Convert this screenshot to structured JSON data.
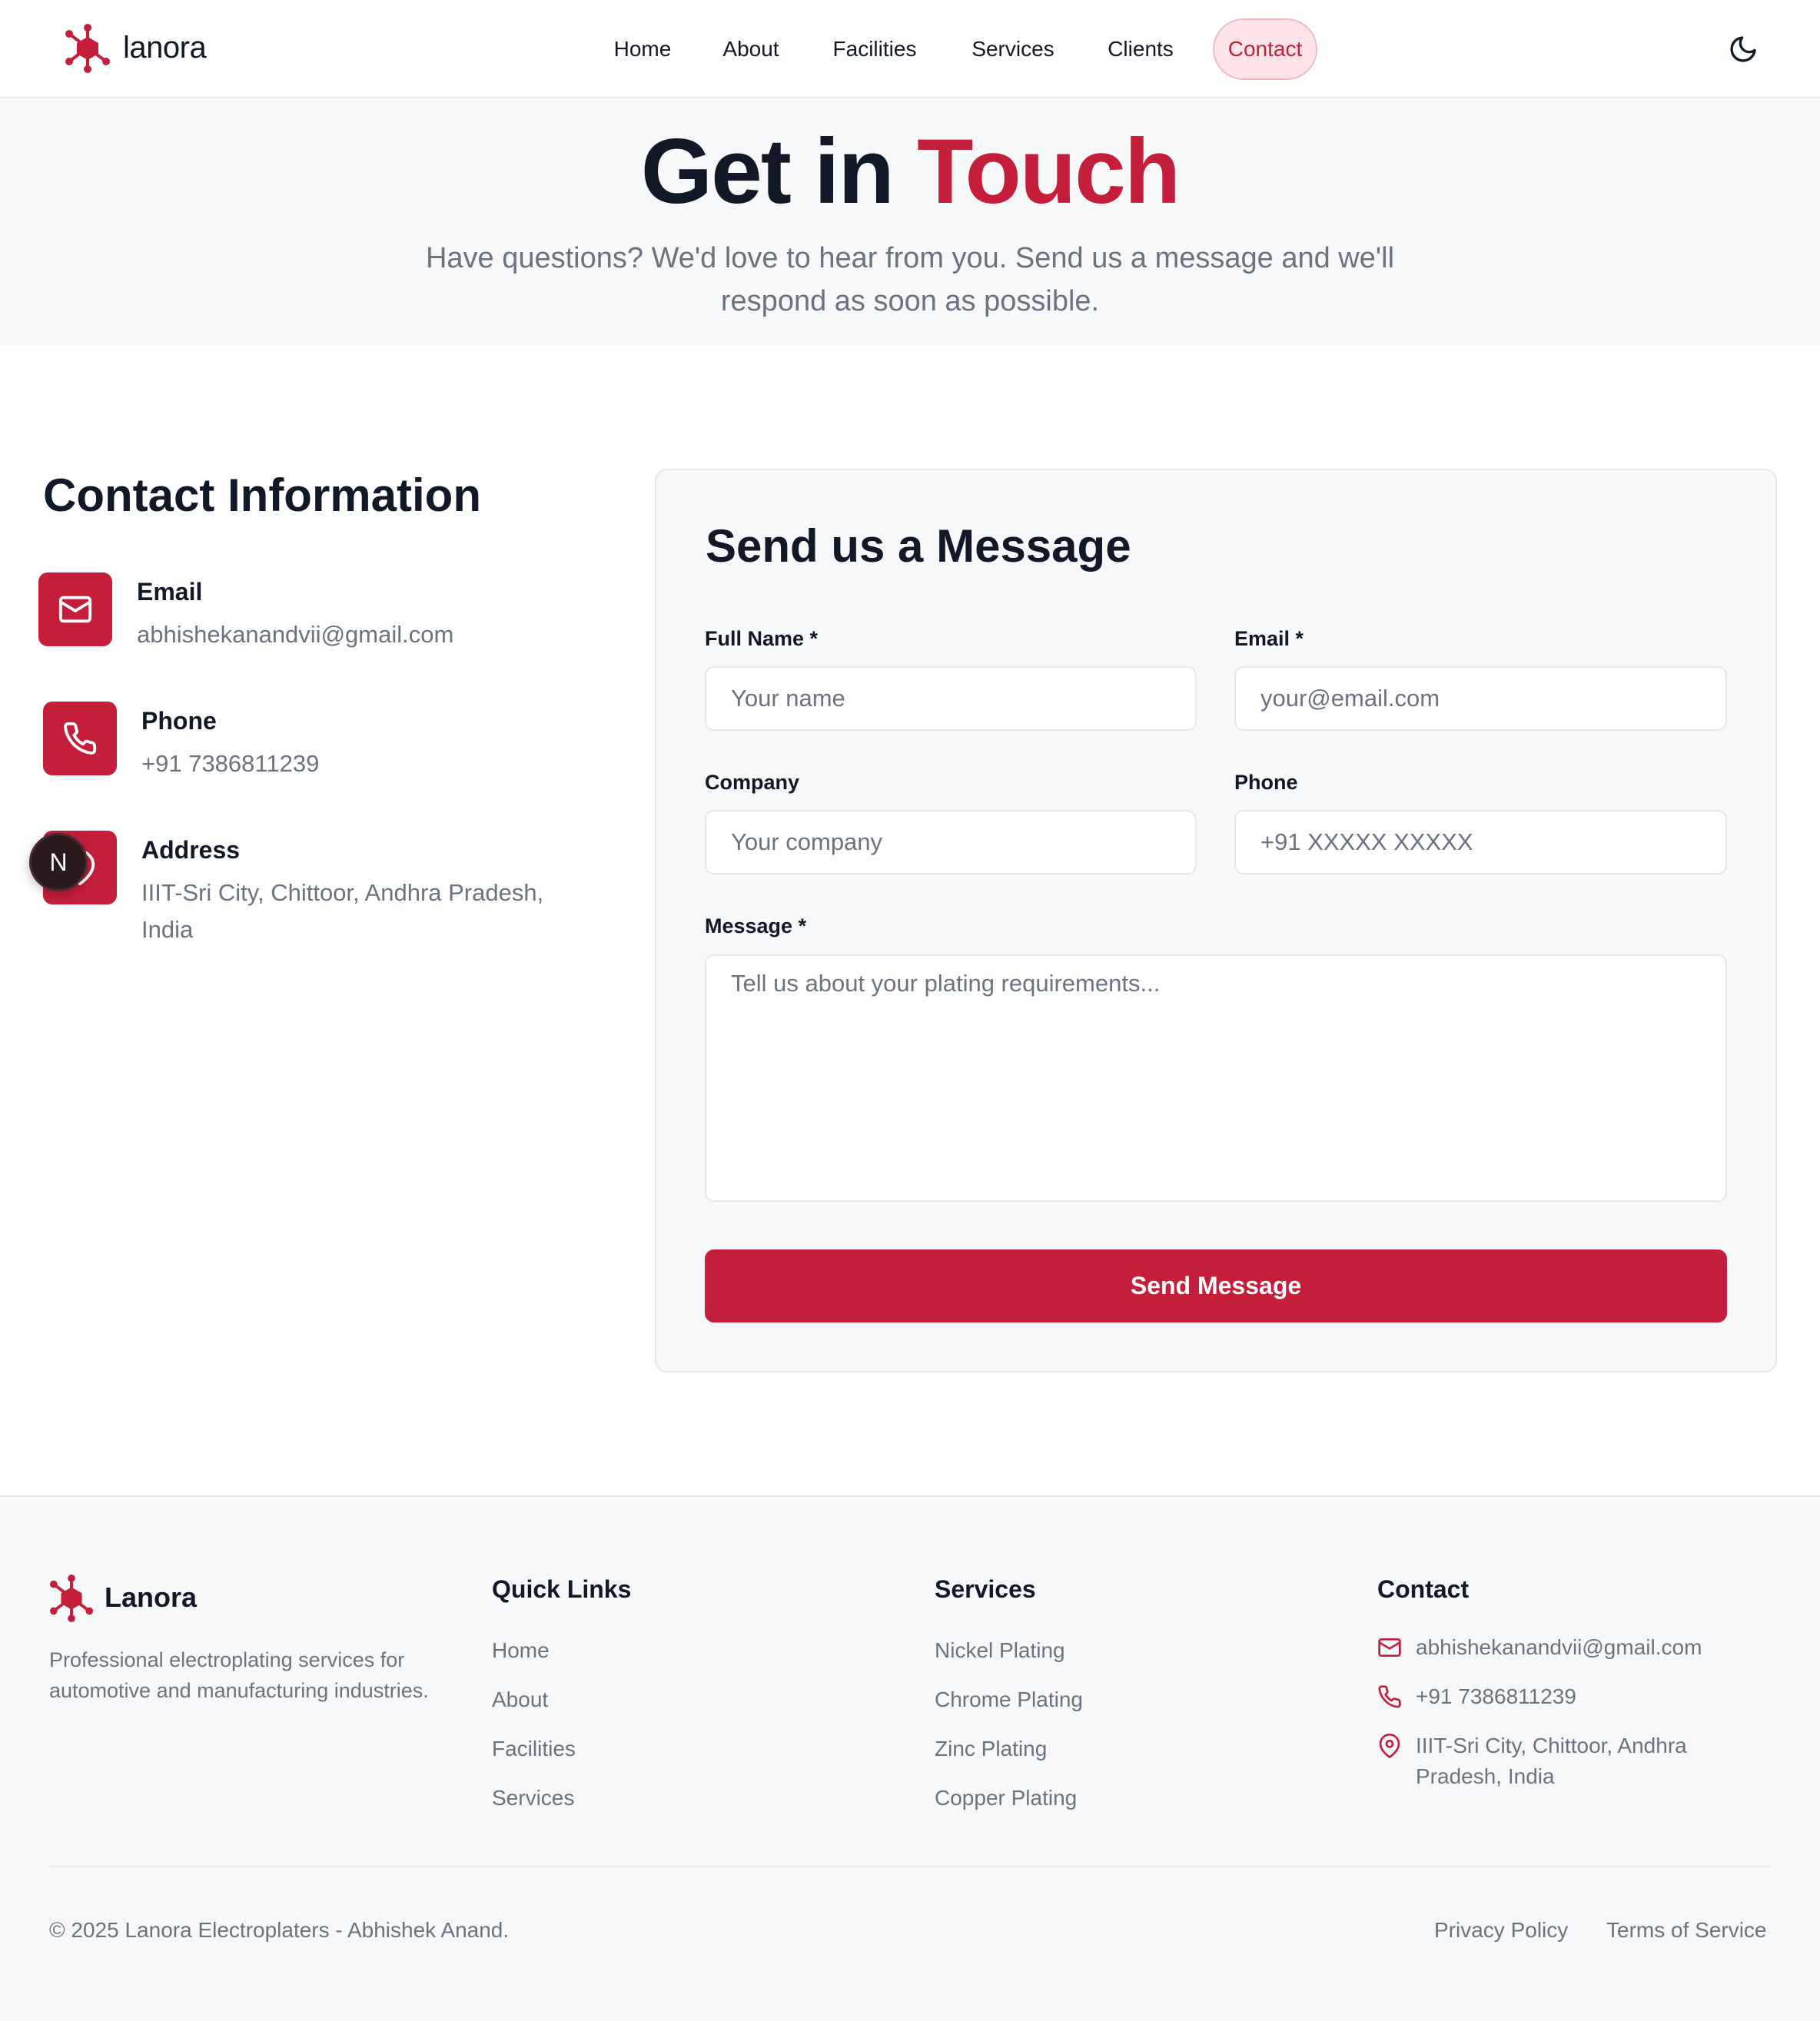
{
  "header": {
    "logo_text": "lanora",
    "nav": [
      {
        "label": "Home"
      },
      {
        "label": "About"
      },
      {
        "label": "Facilities"
      },
      {
        "label": "Services"
      },
      {
        "label": "Clients"
      },
      {
        "label": "Contact",
        "active": true
      }
    ],
    "theme_toggle_icon": "moon-icon"
  },
  "hero": {
    "title_plain": "Get in",
    "title_accent": "Touch",
    "subtitle": "Have questions? We'd love to hear from you. Send us a message and we'll respond as soon as possible."
  },
  "contact_info": {
    "title": "Contact Information",
    "items": [
      {
        "label": "Email",
        "value": "abhishekanandvii@gmail.com",
        "icon": "mail-icon"
      },
      {
        "label": "Phone",
        "value": "+91 7386811239",
        "icon": "phone-icon"
      },
      {
        "label": "Address",
        "value": "IIIT-Sri City, Chittoor, Andhra Pradesh, India",
        "icon": "map-pin-icon"
      }
    ],
    "overlay_badge": "N"
  },
  "form": {
    "title": "Send us a Message",
    "full_name": {
      "label": "Full Name *",
      "placeholder": "Your name"
    },
    "email": {
      "label": "Email *",
      "placeholder": "your@email.com"
    },
    "company": {
      "label": "Company",
      "placeholder": "Your company"
    },
    "phone": {
      "label": "Phone",
      "placeholder": "+91 XXXXX XXXXX"
    },
    "message": {
      "label": "Message *",
      "placeholder": "Tell us about your plating requirements..."
    },
    "submit_label": "Send Message"
  },
  "footer": {
    "brand": "Lanora",
    "description": "Professional electroplating services for automotive and manufacturing industries.",
    "quick_links": {
      "title": "Quick Links",
      "items": [
        "Home",
        "About",
        "Facilities",
        "Services"
      ]
    },
    "services": {
      "title": "Services",
      "items": [
        "Nickel Plating",
        "Chrome Plating",
        "Zinc Plating",
        "Copper Plating"
      ]
    },
    "contact": {
      "title": "Contact",
      "email": "abhishekanandvii@gmail.com",
      "phone": "+91 7386811239",
      "address": "IIIT-Sri City, Chittoor, Andhra Pradesh, India"
    },
    "copyright": "© 2025 Lanora Electroplaters - Abhishek Anand.",
    "privacy": "Privacy Policy",
    "terms": "Terms of Service"
  },
  "colors": {
    "accent": "#c41e3a",
    "muted_text": "#6b7280",
    "surface": "#f7f8fa"
  }
}
